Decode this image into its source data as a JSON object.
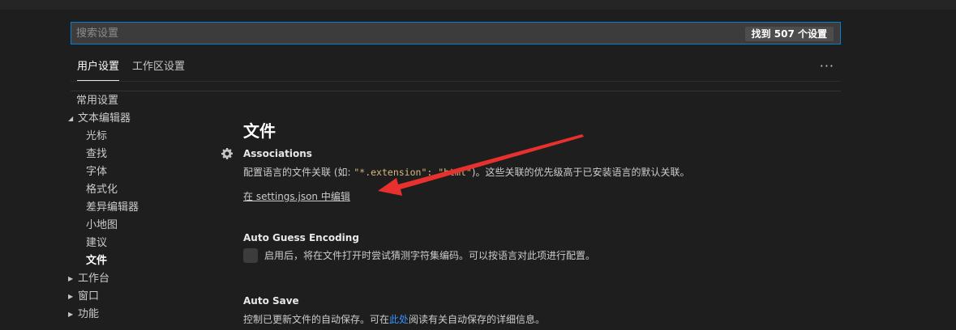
{
  "search": {
    "placeholder": "搜索设置",
    "result_count": "找到 507 个设置"
  },
  "tabs": {
    "user": "用户设置",
    "workspace": "工作区设置",
    "more": "···"
  },
  "toc": {
    "items": [
      {
        "label": "常用设置"
      },
      {
        "label": "文本编辑器",
        "expanded": true
      },
      {
        "label": "光标"
      },
      {
        "label": "查找"
      },
      {
        "label": "字体"
      },
      {
        "label": "格式化"
      },
      {
        "label": "差异编辑器"
      },
      {
        "label": "小地图"
      },
      {
        "label": "建议"
      },
      {
        "label": "文件",
        "selected": true
      },
      {
        "label": "工作台"
      },
      {
        "label": "窗口"
      },
      {
        "label": "功能"
      }
    ]
  },
  "section": {
    "title": "文件"
  },
  "settings": {
    "associations": {
      "title": "Associations",
      "desc_prefix": "配置语言的文件关联 (如: ",
      "code1": "\"*.extension\": \"html\"",
      "desc_suffix": ")。这些关联的优先级高于已安装语言的默认关联。",
      "edit_link": "在 settings.json 中编辑"
    },
    "auto_guess_encoding": {
      "title": "Auto Guess Encoding",
      "checked": false,
      "label": "启用后，将在文件打开时尝试猜测字符集编码。可以按语言对此项进行配置。"
    },
    "auto_save": {
      "title": "Auto Save",
      "desc_prefix": "控制已更新文件的自动保存。可在",
      "link": "此处",
      "desc_suffix": "阅读有关自动保存的详细信息。"
    }
  },
  "colors": {
    "accent_link": "#3794ff",
    "focus_border": "#007fd4",
    "annotation_arrow": "#e8312f"
  }
}
